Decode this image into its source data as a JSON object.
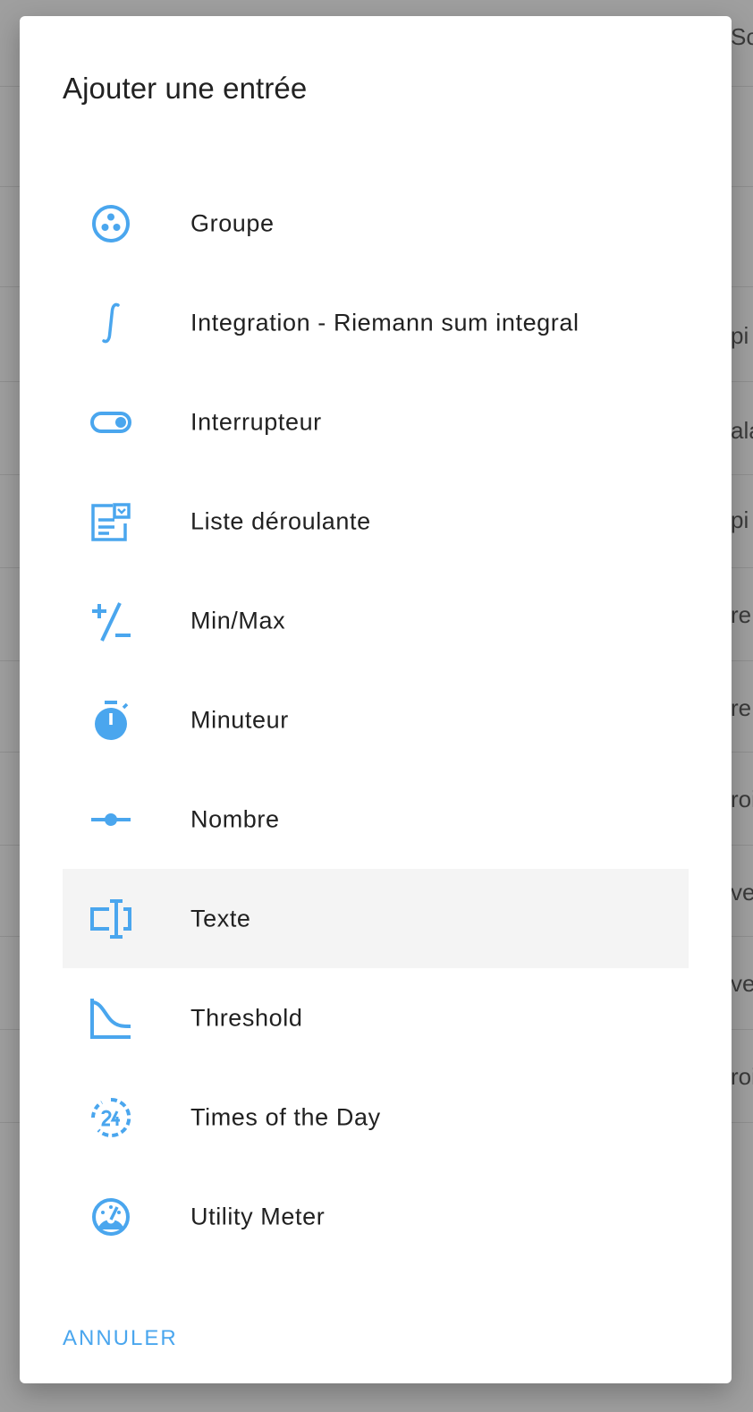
{
  "dialog": {
    "title": "Ajouter une entrée",
    "cancel_label": "ANNULER",
    "accent_color": "#4aa6ee",
    "items": [
      {
        "label": "",
        "icon": "partial-icon"
      },
      {
        "label": "Groupe",
        "icon": "group-icon"
      },
      {
        "label": "Integration - Riemann sum integral",
        "icon": "integral-icon"
      },
      {
        "label": "Interrupteur",
        "icon": "toggle-switch-icon"
      },
      {
        "label": "Liste déroulante",
        "icon": "form-dropdown-icon"
      },
      {
        "label": "Min/Max",
        "icon": "plus-minus-icon"
      },
      {
        "label": "Minuteur",
        "icon": "timer-icon"
      },
      {
        "label": "Nombre",
        "icon": "slider-icon"
      },
      {
        "label": "Texte",
        "icon": "text-cursor-icon",
        "selected": true
      },
      {
        "label": "Threshold",
        "icon": "threshold-curve-icon"
      },
      {
        "label": "Times of the Day",
        "icon": "clock-24-icon"
      },
      {
        "label": "Utility Meter",
        "icon": "gauge-icon"
      }
    ]
  },
  "background": {
    "fragments": [
      "Sc",
      "pi",
      "ala",
      "pi",
      "re",
      "re",
      "roi",
      "ve",
      "ve",
      "roi"
    ]
  }
}
